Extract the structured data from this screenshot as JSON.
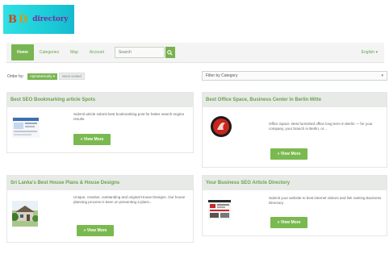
{
  "logo": {
    "letter1": "B",
    "letter2": "D",
    "text": "directory"
  },
  "nav": {
    "items": [
      {
        "label": "Home",
        "active": true
      },
      {
        "label": "Categories",
        "active": false
      },
      {
        "label": "Map",
        "active": false
      },
      {
        "label": "Account",
        "active": false
      }
    ],
    "search_placeholder": "Search",
    "language": "English"
  },
  "order_by": {
    "label": "Order by:",
    "option1": "Alphabetically",
    "option2": "Most visited"
  },
  "filter": {
    "label": "Filter by Category"
  },
  "cards": [
    {
      "title": "Best SEO Bookmarking article Spots",
      "description": "Submit article submit best bookmarking post for better search engine results.",
      "button": "View More"
    },
    {
      "title": "Best Office Space, Business Center in Berlin Mitte",
      "description": "Office Space. Best furnished office long term in Berlin — for your company, your branch in Berlin, or...",
      "button": "View More"
    },
    {
      "title": "Sri Lanka's Best House Plans & House Designs",
      "description": "Unique, creative, outstanding and original House Designs. Our house planning process is keen on presenting a plans...",
      "button": "View More"
    },
    {
      "title": "Your Business SEO Article Directory",
      "description": "Submit your website to best internet visitors and link ranking Business Directory.",
      "button": "View More"
    }
  ],
  "colors": {
    "accent": "#79b552",
    "logo_bg": "#2fe0e4",
    "header_bg": "#e8eae8"
  }
}
